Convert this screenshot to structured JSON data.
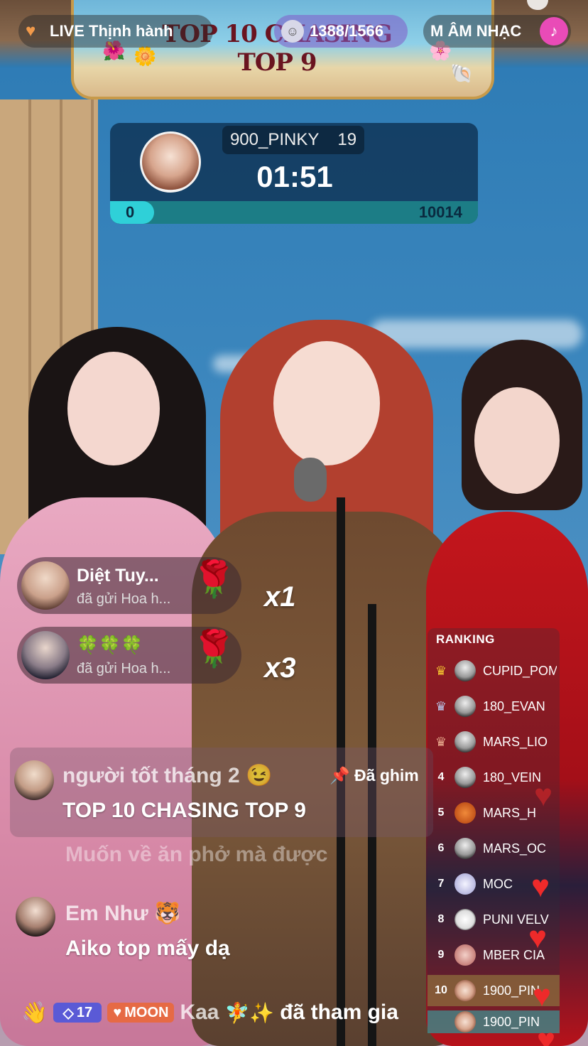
{
  "top_bar": {
    "live_label": "LIVE Thịnh hành",
    "viewer_count": "1388/1566",
    "music_label": "M ÂM NHẠC"
  },
  "banner": {
    "title": "TOP 10 CHASING TOP 9"
  },
  "battle": {
    "user": "900_PINKY",
    "user_rank": "19",
    "timer": "01:51",
    "left_score": "0",
    "right_score": "10014",
    "progress_fraction": 0.12
  },
  "gifts": [
    {
      "name": "Diệt Tuy...",
      "action": "đã gửi Hoa h...",
      "icon": "rose-icon",
      "count": "x1"
    },
    {
      "name": "🍀🍀🍀",
      "action": "đã gửi Hoa h...",
      "icon": "rose-icon",
      "count": "x3"
    }
  ],
  "chat": {
    "pinned": {
      "user": "người tốt tháng 2 😉",
      "pin_label": "Đã ghim",
      "message": "TOP 10 CHASING TOP 9"
    },
    "faded_message": "Muốn về ăn phở mà được",
    "messages": [
      {
        "user": "Em Như 🐯",
        "message": "Aiko top mấy dạ"
      }
    ],
    "join": {
      "level": "17",
      "fan_badge": "MOON",
      "name": "Kaa",
      "deco": "🧚✨",
      "text": "đã tham gia"
    }
  },
  "ranking": {
    "title": "RANKING",
    "rows": [
      {
        "rank": "1",
        "name": "CUPID_POM"
      },
      {
        "rank": "2",
        "name": "180_EVAN"
      },
      {
        "rank": "3",
        "name": "MARS_LIO"
      },
      {
        "rank": "4",
        "name": "180_VEIN"
      },
      {
        "rank": "5",
        "name": "MARS_H"
      },
      {
        "rank": "6",
        "name": "MARS_OC"
      },
      {
        "rank": "7",
        "name": "MOC"
      },
      {
        "rank": "8",
        "name": "PUNI VELV"
      },
      {
        "rank": "9",
        "name": "MBER CIA"
      },
      {
        "rank": "10",
        "name": "1900_PIN"
      },
      {
        "rank": "",
        "name": "1900_PIN"
      }
    ]
  },
  "colors": {
    "rank_highlight": "#8c6e3c",
    "battle_bar": "#2fd0d8",
    "heart": "#ee2a2a"
  }
}
